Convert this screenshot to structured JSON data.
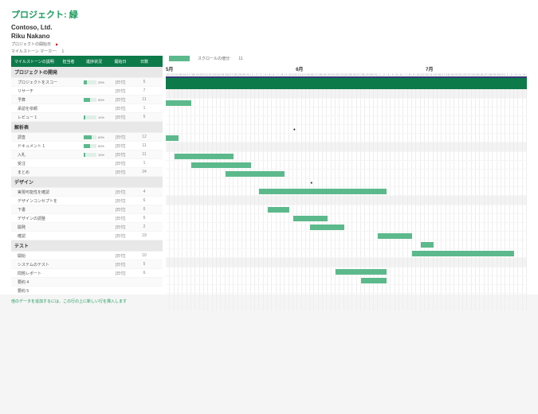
{
  "title": "プロジェクト: 緑",
  "company": "Contoso, Ltd.",
  "manager": "Riku Nakano",
  "meta": {
    "start_label": "プロジェクトの開始日",
    "marker_label": "マイルストーン マーカー:",
    "marker_value": "1"
  },
  "legend": {
    "scroll_label": "スクロールの増分:",
    "scroll_value": "11"
  },
  "headers": {
    "milestone": "マイルストーンの説明",
    "owner": "担当者",
    "progress": "進捗状況",
    "start": "開始日",
    "days": "日数"
  },
  "months": [
    "5月",
    "6月",
    "7月"
  ],
  "sections": [
    {
      "name": "プロジェクトの開発",
      "tasks": [
        {
          "name": "プロジェクトをスコープ",
          "owner": "",
          "progress": 25,
          "start": "[日付]",
          "days": "5"
        },
        {
          "name": "リサーチ",
          "owner": "",
          "progress": null,
          "start": "[日付]",
          "days": "7"
        },
        {
          "name": "予算",
          "owner": "",
          "progress": 50,
          "start": "[日付]",
          "days": "11"
        },
        {
          "name": "承認を依頼",
          "owner": "",
          "progress": null,
          "start": "[日付]",
          "days": "1"
        },
        {
          "name": "レビュー 1",
          "owner": "",
          "progress": 10,
          "start": "[日付]",
          "days": "5"
        }
      ]
    },
    {
      "name": "解析表",
      "tasks": [
        {
          "name": "調査",
          "owner": "",
          "progress": 60,
          "start": "[日付]",
          "days": "12"
        },
        {
          "name": "ドキュメント 1",
          "owner": "",
          "progress": 50,
          "start": "[日付]",
          "days": "11"
        },
        {
          "name": "入札",
          "owner": "",
          "progress": 10,
          "start": "[日付]",
          "days": "11"
        },
        {
          "name": "受注",
          "owner": "",
          "progress": null,
          "start": "[日付]",
          "days": "1"
        },
        {
          "name": "まとめ",
          "owner": "",
          "progress": null,
          "start": "[日付]",
          "days": "24"
        }
      ]
    },
    {
      "name": "デザイン",
      "tasks": [
        {
          "name": "実現可能性を確認",
          "owner": "",
          "progress": null,
          "start": "[日付]",
          "days": "4"
        },
        {
          "name": "デザインコンセプトを定義",
          "owner": "",
          "progress": null,
          "start": "[日付]",
          "days": "6"
        },
        {
          "name": "下書",
          "owner": "",
          "progress": null,
          "start": "[日付]",
          "days": "6"
        },
        {
          "name": "デザインの調整",
          "owner": "",
          "progress": null,
          "start": "[日付]",
          "days": "6"
        },
        {
          "name": "開発",
          "owner": "",
          "progress": null,
          "start": "[日付]",
          "days": "2"
        },
        {
          "name": "確認",
          "owner": "",
          "progress": null,
          "start": "[日付]",
          "days": "19"
        }
      ]
    },
    {
      "name": "テスト",
      "tasks": [
        {
          "name": "開始",
          "owner": "",
          "progress": null,
          "start": "[日付]",
          "days": "10"
        },
        {
          "name": "システムのテスト",
          "owner": "",
          "progress": null,
          "start": "[日付]",
          "days": "5"
        },
        {
          "name": "問題レポート",
          "owner": "",
          "progress": null,
          "start": "[日付]",
          "days": "6"
        },
        {
          "name": "要約 4",
          "owner": "",
          "progress": null,
          "start": "",
          "days": ""
        },
        {
          "name": "要約 5",
          "owner": "",
          "progress": null,
          "start": "",
          "days": ""
        }
      ]
    }
  ],
  "footer": "他のデータを追加するには、この行の上に新しい行を挿入します",
  "chart_data": {
    "type": "gantt",
    "bars": [
      {
        "row": 1,
        "start": 0,
        "width": 6
      },
      {
        "row": 2,
        "start": 0,
        "width": 0
      },
      {
        "row": 3,
        "start": 0,
        "width": 0
      },
      {
        "row": 4,
        "start": 30,
        "width": 0,
        "milestone": true
      },
      {
        "row": 5,
        "start": 0,
        "width": 3
      },
      {
        "row": 7,
        "start": 2,
        "width": 14
      },
      {
        "row": 8,
        "start": 6,
        "width": 14
      },
      {
        "row": 9,
        "start": 14,
        "width": 14
      },
      {
        "row": 10,
        "start": 34,
        "width": 0,
        "milestone": true
      },
      {
        "row": 11,
        "start": 22,
        "width": 30
      },
      {
        "row": 13,
        "start": 24,
        "width": 5
      },
      {
        "row": 14,
        "start": 30,
        "width": 8
      },
      {
        "row": 15,
        "start": 34,
        "width": 8
      },
      {
        "row": 16,
        "start": 50,
        "width": 8
      },
      {
        "row": 17,
        "start": 60,
        "width": 3
      },
      {
        "row": 18,
        "start": 58,
        "width": 24
      },
      {
        "row": 20,
        "start": 40,
        "width": 12
      },
      {
        "row": 21,
        "start": 46,
        "width": 6
      },
      {
        "row": 22,
        "start": 0,
        "width": 0
      },
      {
        "row": 23,
        "start": 0,
        "width": 0
      },
      {
        "row": 24,
        "start": 0,
        "width": 0
      }
    ]
  }
}
